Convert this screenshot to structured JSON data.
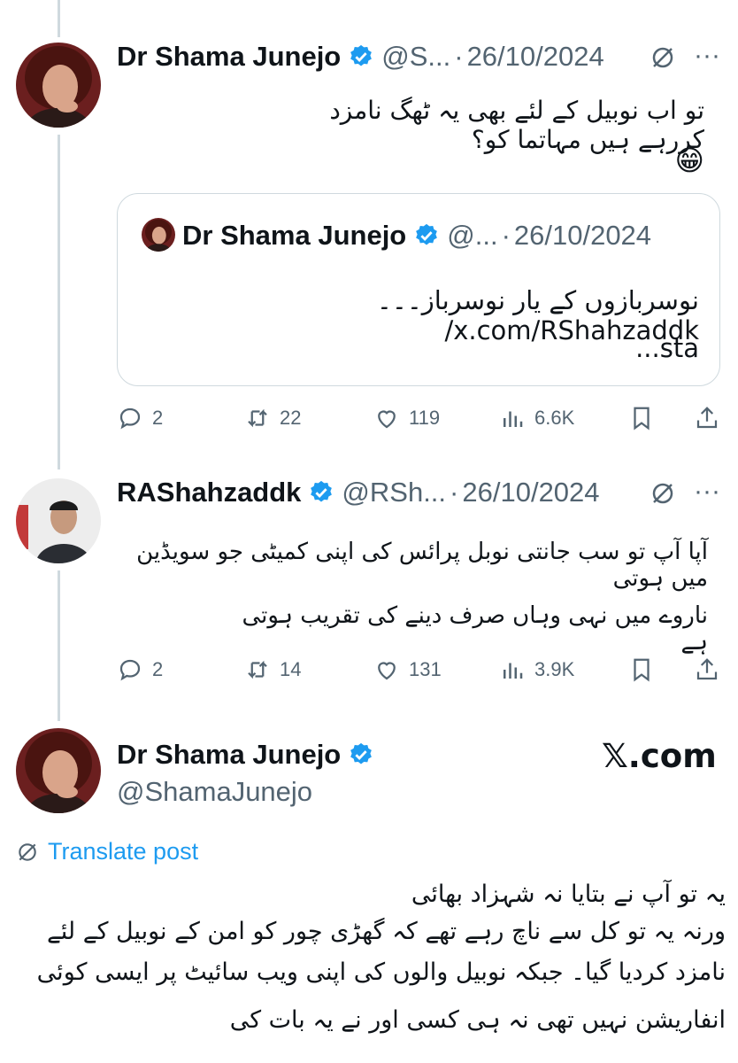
{
  "tweet1": {
    "name": "Dr Shama Junejo",
    "handle": "@S...",
    "dot": "·",
    "date": "26/10/2024",
    "text": "تو اب نوبیل کے لئے بھی یہ ٹھگ نامزد کررہے ہیں مہاتما کو؟",
    "emoji": "😁",
    "quote": {
      "name": "Dr Shama Junejo",
      "handle": "@...",
      "dot": "·",
      "date": "26/10/2024",
      "text_line1": "نوسربازوں کے یار نوسرباز۔۔۔ x.com/RShahzaddk/",
      "text_line2": "sta..."
    },
    "stats": {
      "replies": "2",
      "reposts": "22",
      "likes": "119",
      "views": "6.6K"
    }
  },
  "tweet2": {
    "name": "RAShahzaddk",
    "handle": "@RSh...",
    "dot": "·",
    "date": "26/10/2024",
    "text_line1": "آپا آپ تو سب جانتی نوبل پرائس کی اپنی کمیٹی جو سویڈین میں ہوتی",
    "text_line2": "ناروے میں نہی وہاں صرف دینے کی تقریب ہوتی ہے",
    "stats": {
      "replies": "2",
      "reposts": "14",
      "likes": "131",
      "views": "3.9K"
    }
  },
  "main": {
    "name": "Dr Shama Junejo",
    "handle": "@ShamaJunejo",
    "brand": "𝕏.com",
    "translate_label": "Translate post",
    "text_lines": [
      "یہ تو آپ نے بتایا نہ شہزاد بھائی",
      "ورنہ یہ تو کل سے ناچ رہے تھے کہ گھڑی چور کو امن کے نوبیل کے لئے",
      "نامزد کردیا گیا۔ جبکہ نوبیل والوں کی اپنی ویب سائیٹ پر ایسی کوئی",
      "انفاریشن نہیں تھی نہ ہی کسی اور نے یہ بات کی"
    ]
  },
  "icons": {
    "grok": "grok-icon",
    "more": "more-icon",
    "verified": "verified-badge-icon",
    "reply": "reply-icon",
    "repost": "repost-icon",
    "like": "like-icon",
    "views": "views-icon",
    "bookmark": "bookmark-icon",
    "share": "share-icon",
    "translate": "translate-icon"
  },
  "colors": {
    "verified": "#1d9bf0",
    "link": "#1d9bf0",
    "muted": "#536471",
    "border": "#cfd9de"
  }
}
